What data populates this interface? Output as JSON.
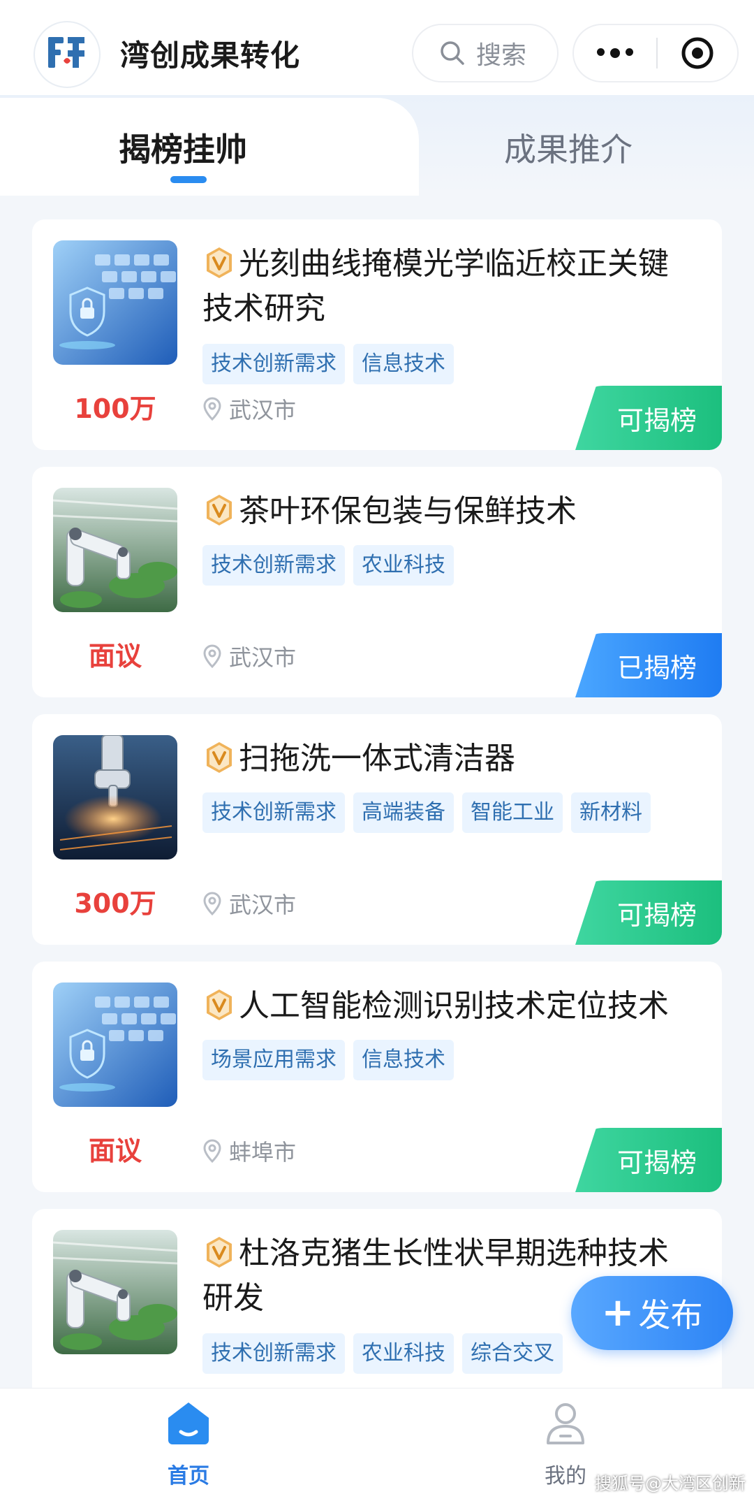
{
  "header": {
    "app_title": "湾创成果转化",
    "search_label": "搜索"
  },
  "tabs": [
    {
      "label": "揭榜挂帅",
      "active": true
    },
    {
      "label": "成果推介",
      "active": false
    }
  ],
  "cards": [
    {
      "title": "光刻曲线掩模光学临近校正关键技术研究",
      "tags": [
        "技术创新需求",
        "信息技术"
      ],
      "price": "100万",
      "location": "武汉市",
      "status": "可揭榜",
      "status_type": "open",
      "image": "keyboard-security-image"
    },
    {
      "title": "茶叶环保包装与保鲜技术",
      "tags": [
        "技术创新需求",
        "农业科技"
      ],
      "price": "面议",
      "location": "武汉市",
      "status": "已揭榜",
      "status_type": "taken",
      "image": "robot-arm-greenhouse-image"
    },
    {
      "title": "扫拖洗一体式清洁器",
      "tags": [
        "技术创新需求",
        "高端装备",
        "智能工业",
        "新材料"
      ],
      "price": "300万",
      "location": "武汉市",
      "status": "可揭榜",
      "status_type": "open",
      "image": "industrial-laser-robot-image"
    },
    {
      "title": "人工智能检测识别技术定位技术",
      "tags": [
        "场景应用需求",
        "信息技术"
      ],
      "price": "面议",
      "location": "蚌埠市",
      "status": "可揭榜",
      "status_type": "open",
      "image": "keyboard-security-image"
    },
    {
      "title": "杜洛克猪生长性状早期选种技术研发",
      "tags": [
        "技术创新需求",
        "农业科技",
        "综合交叉"
      ],
      "image": "robot-arm-greenhouse-image"
    }
  ],
  "publish_button": {
    "label": "发布"
  },
  "bottom_nav": [
    {
      "label": "首页",
      "icon": "home-icon",
      "active": true
    },
    {
      "label": "我的",
      "icon": "user-icon",
      "active": false
    }
  ],
  "watermark": "搜狐号@大湾区创新",
  "colors": {
    "accent": "#2a8cf0",
    "price": "#e8413c",
    "status_open": "#1cbf7e",
    "status_taken": "#1f7cf2",
    "tag_bg": "#eaf4ff",
    "tag_text": "#2f6fb0"
  }
}
